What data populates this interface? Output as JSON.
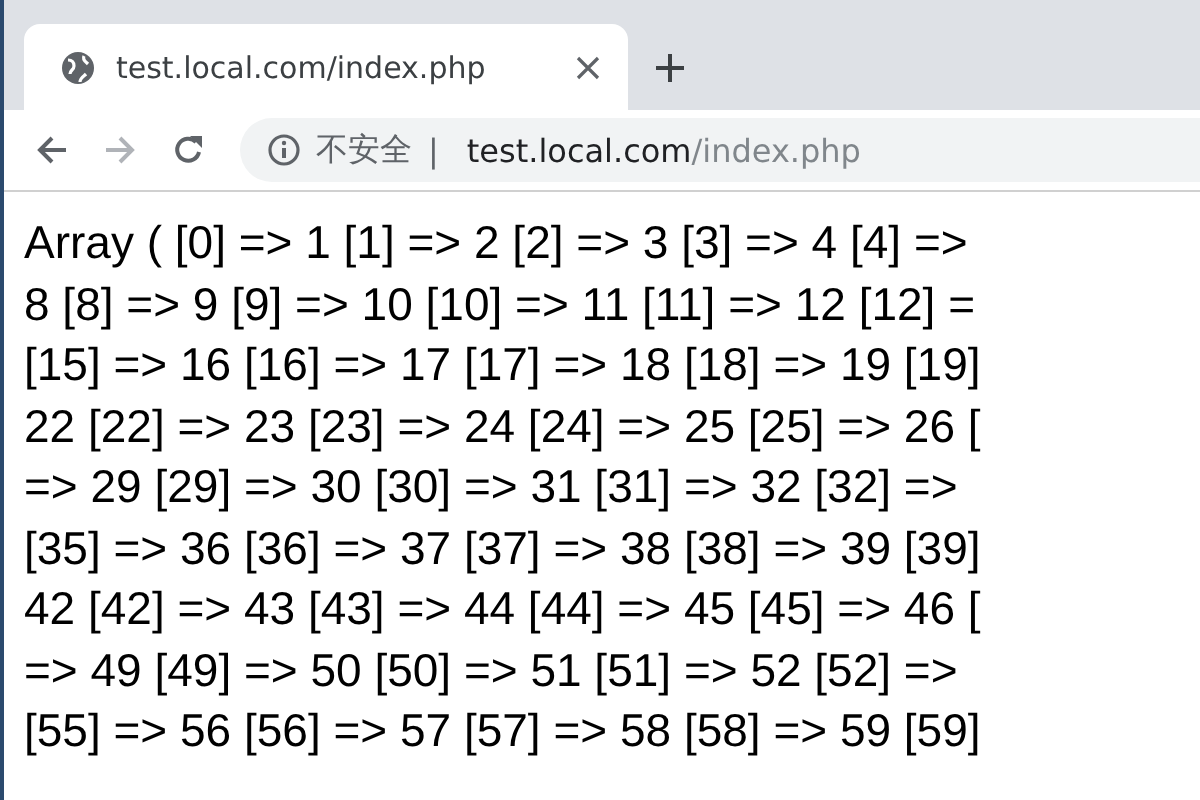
{
  "tab": {
    "title": "test.local.com/index.php",
    "selected": true
  },
  "address_bar": {
    "security_label": "不安全",
    "separator": "|",
    "url_host": "test.local.com",
    "url_path": "/index.php"
  },
  "page": {
    "lines": [
      "Array ( [0] => 1 [1] => 2 [2] => 3 [3] => 4 [4] =>",
      "8 [8] => 9 [9] => 10 [10] => 11 [11] => 12 [12] =",
      "[15] => 16 [16] => 17 [17] => 18 [18] => 19 [19]",
      "22 [22] => 23 [23] => 24 [24] => 25 [25] => 26 [",
      "=> 29 [29] => 30 [30] => 31 [31] => 32 [32] =>",
      "[35] => 36 [36] => 37 [37] => 38 [38] => 39 [39]",
      "42 [42] => 43 [43] => 44 [44] => 45 [45] => 46 [",
      "=> 49 [49] => 50 [50] => 51 [51] => 52 [52] =>",
      "[55] => 56 [56] => 57 [57] => 58 [58] => 59 [59]"
    ]
  }
}
